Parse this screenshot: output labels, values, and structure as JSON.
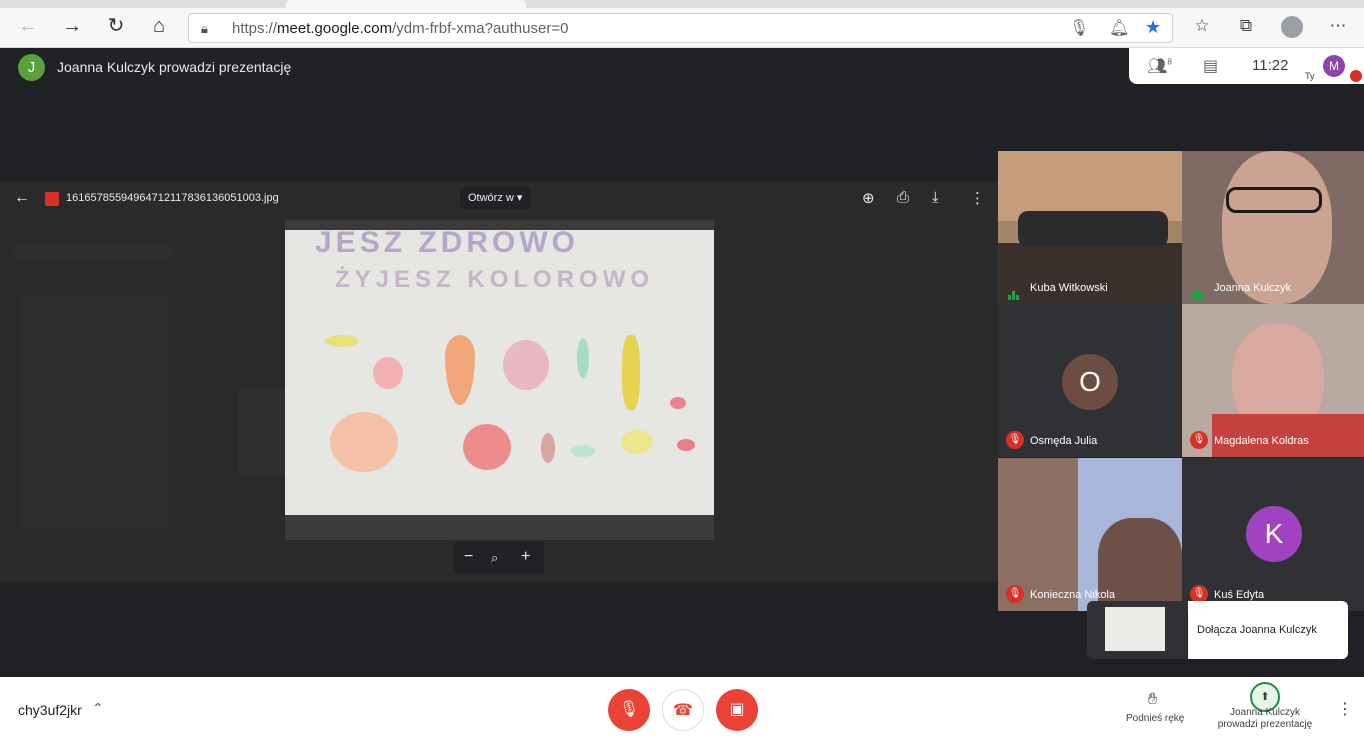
{
  "browser": {
    "url_prefix": "https://",
    "url_host": "meet.google.com",
    "url_path": "/ydm-frbf-xma?authuser=0",
    "icons": [
      "back-icon",
      "forward-icon",
      "reload-icon",
      "home-icon",
      "lock-icon",
      "mic-icon",
      "bell-icon",
      "star-icon",
      "favorites-icon",
      "collections-icon",
      "profile-icon",
      "more-icon"
    ]
  },
  "meeting": {
    "presenter_initial": "J",
    "presenter_text": "Joanna Kulczyk prowadzi prezentację",
    "time": "11:22",
    "people_count": "8",
    "self_label": "Ty",
    "self_initial": "M",
    "code": "chy3uf2jkr"
  },
  "viewer": {
    "filename": "16165785594964712117836136051003.jpg",
    "open_with": "Otwórz w",
    "photo_line1": "JESZ ZDROWO",
    "photo_line2": "ŻYJESZ KOLOROWO"
  },
  "participants": [
    {
      "name": "Kuba Witkowski",
      "muted": false
    },
    {
      "name": "Joanna Kulczyk",
      "muted": false
    },
    {
      "name": "Osmęda Julia",
      "muted": true,
      "initial": "O",
      "color": "#6d4c41"
    },
    {
      "name": "Magdalena Koldras",
      "muted": true
    },
    {
      "name": "Konieczna Nikola",
      "muted": true
    },
    {
      "name": "Kuś Edyta",
      "muted": true,
      "initial": "K",
      "color": "#a142c1"
    }
  ],
  "notification": {
    "text": "Dołącza Joanna Kulczyk"
  },
  "controls": {
    "raise_hand": "Podnieś rękę",
    "presenting": "Joanna Kulczyk prowadzi prezentację"
  },
  "colors": {
    "danger": "#ea4335",
    "accent": "#1a73e8",
    "speaking": "#1ea446"
  }
}
